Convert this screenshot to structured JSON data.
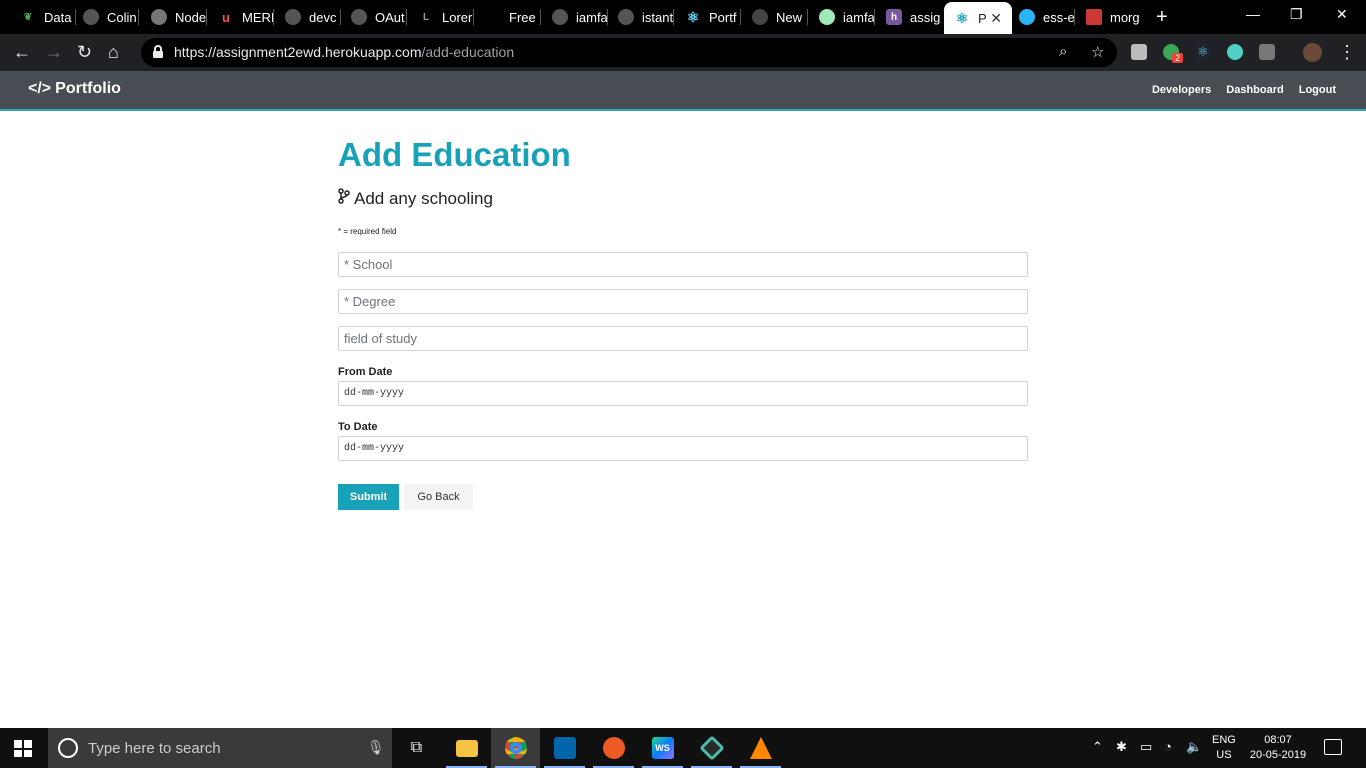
{
  "browser": {
    "tabs": [
      {
        "title": "Data",
        "icon": "mongodb-leaf-icon",
        "color": "#4caf50"
      },
      {
        "title": "Colin",
        "icon": "github-icon",
        "color": "#555555"
      },
      {
        "title": "Node",
        "icon": "globe-icon",
        "color": "#777777"
      },
      {
        "title": "MERI",
        "icon": "udemy-icon",
        "color": "#ec5252"
      },
      {
        "title": "devc",
        "icon": "github-icon",
        "color": "#555555"
      },
      {
        "title": "OAut",
        "icon": "github-icon",
        "color": "#555555"
      },
      {
        "title": "Lorer",
        "icon": "lorem-icon",
        "color": "#888888"
      },
      {
        "title": "Free",
        "icon": "blank-icon",
        "color": "#000000"
      },
      {
        "title": "iamfa",
        "icon": "github-icon",
        "color": "#555555"
      },
      {
        "title": "istant",
        "icon": "github-icon",
        "color": "#555555"
      },
      {
        "title": "Portf",
        "icon": "react-icon",
        "color": "#61dafb"
      },
      {
        "title": "New",
        "icon": "github-icon",
        "color": "#555555"
      },
      {
        "title": "iamfa",
        "icon": "codesandbox-icon",
        "color": "#9fe8b8"
      },
      {
        "title": "assig",
        "icon": "heroku-icon",
        "color": "#79589f"
      },
      {
        "title": "P",
        "icon": "react-icon",
        "color": "#61dafb",
        "active": true
      },
      {
        "title": "ess-e",
        "icon": "eye-icon",
        "color": "#29b6f6"
      },
      {
        "title": "morg",
        "icon": "npm-icon",
        "color": "#cb3837"
      }
    ],
    "url_host": "https://assignment2ewd.herokuapp.com",
    "url_path": "/add-education",
    "profile_badge": "2"
  },
  "site": {
    "brand": "Portfolio",
    "nav": [
      "Developers",
      "Dashboard",
      "Logout"
    ]
  },
  "form": {
    "title": "Add Education",
    "lead": "Add any schooling",
    "required_note": "* = required field",
    "school_placeholder": "* School",
    "degree_placeholder": "* Degree",
    "field_placeholder": "field of study",
    "from_label": "From Date",
    "from_value": "dd-mm-yyyy",
    "to_label": "To Date",
    "to_value": "dd-mm-yyyy",
    "submit_label": "Submit",
    "back_label": "Go Back"
  },
  "taskbar": {
    "search_placeholder": "Type here to search",
    "lang_line1": "ENG",
    "lang_line2": "US",
    "time": "08:07",
    "date": "20-05-2019"
  },
  "colors": {
    "accent": "#17a2b8",
    "navbar": "#343a40"
  }
}
